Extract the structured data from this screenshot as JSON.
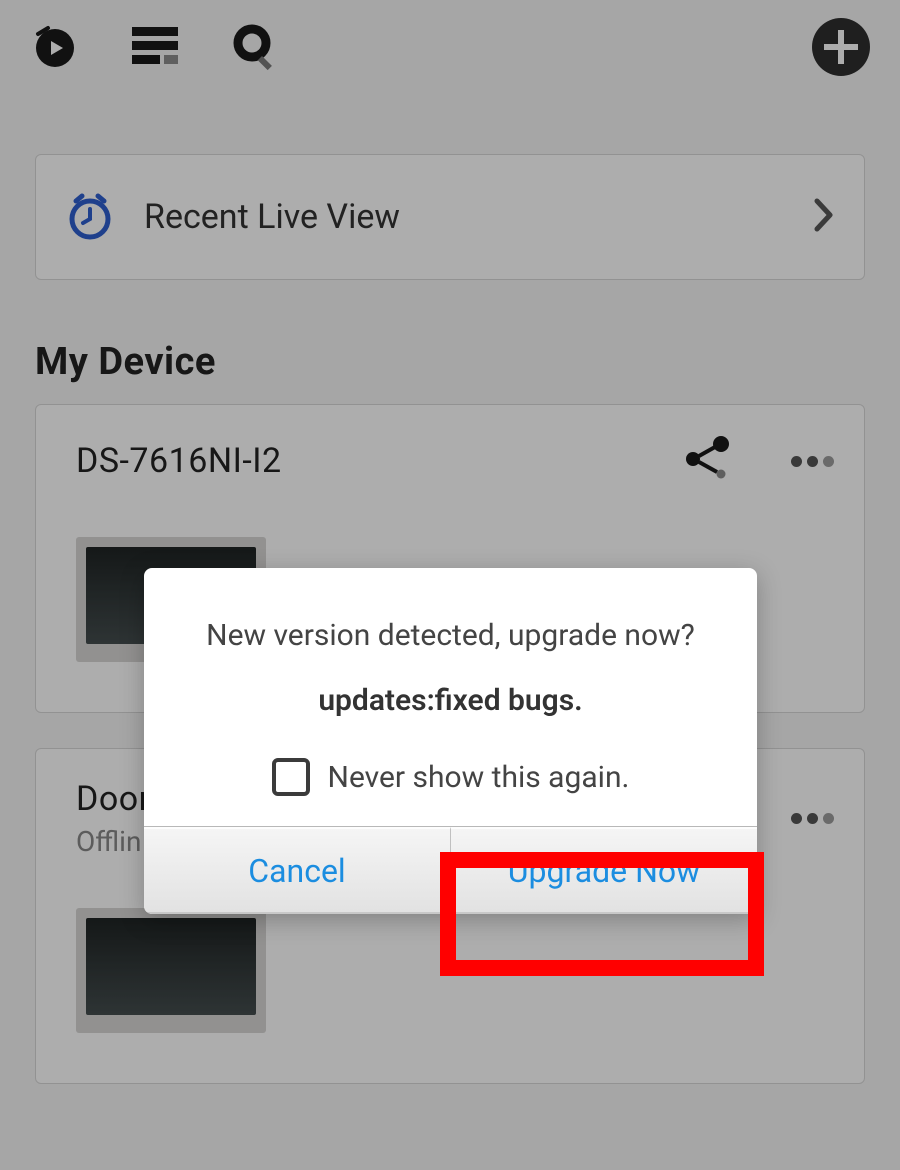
{
  "header": {
    "icons": {
      "play": "play-icon",
      "list": "list-icon",
      "search": "search-icon",
      "add": "plus-icon"
    }
  },
  "recent": {
    "title": "Recent Live View"
  },
  "section": {
    "my_device": "My Device"
  },
  "devices": [
    {
      "name": "DS-7616NI-I2",
      "status": ""
    },
    {
      "name": "Door",
      "status": "Offlin"
    }
  ],
  "dialog": {
    "title": "New version detected, upgrade now?",
    "subtitle": "updates:fixed bugs.",
    "never_show": "Never show this again.",
    "cancel": "Cancel",
    "upgrade": "Upgrade Now"
  }
}
